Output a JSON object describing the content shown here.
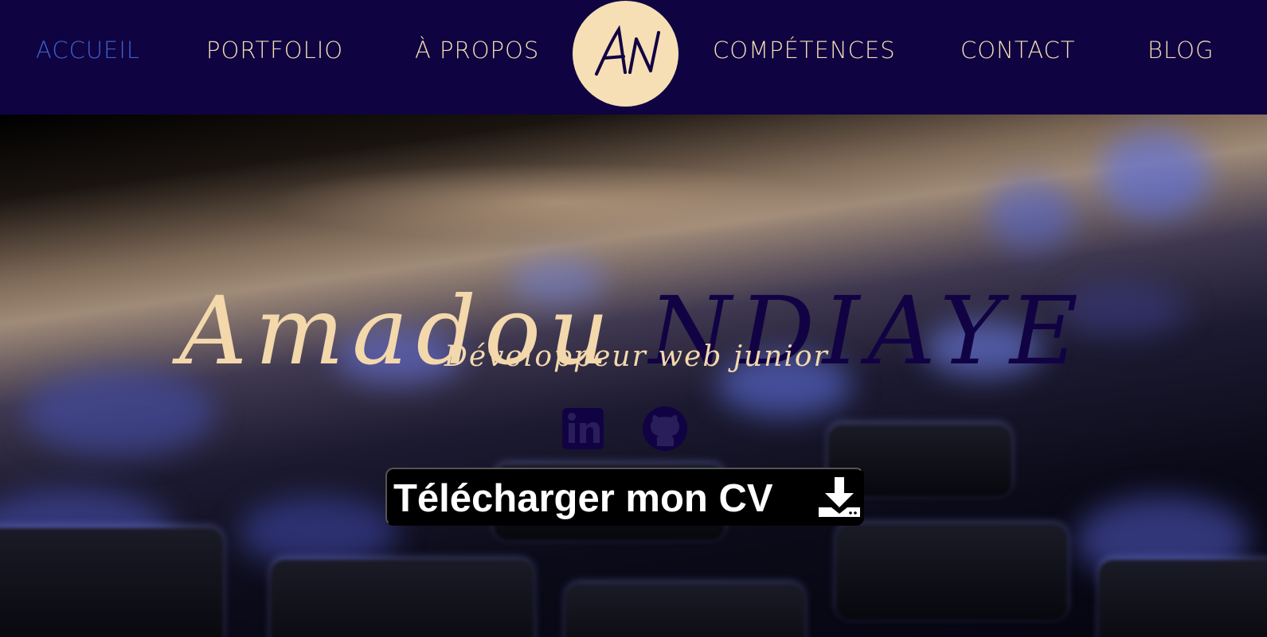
{
  "nav": {
    "items": [
      {
        "label": "ACCUEIL",
        "active": true
      },
      {
        "label": "PORTFOLIO",
        "active": false
      },
      {
        "label": "À PROPOS",
        "active": false
      },
      {
        "label": "COMPÉTENCES",
        "active": false
      },
      {
        "label": "CONTACT",
        "active": false
      },
      {
        "label": "BLOG",
        "active": false
      }
    ],
    "logo_text": "AN"
  },
  "hero": {
    "first_name": "Amadou",
    "last_name": "NDIAYE",
    "subtitle": "Développeur web junior",
    "social": [
      {
        "icon": "linkedin-icon"
      },
      {
        "icon": "github-icon"
      }
    ],
    "cv_button_label": "Télécharger mon CV",
    "cv_icon": "download-icon"
  },
  "colors": {
    "navbar_bg": "#0f0342",
    "nav_text": "#f5deb3",
    "nav_active": "#3d61c9",
    "logo_bg": "#f6dfb5",
    "accent_dark": "#110343",
    "cream": "#f3d8ac",
    "button_bg": "#000000",
    "button_text": "#ffffff"
  }
}
